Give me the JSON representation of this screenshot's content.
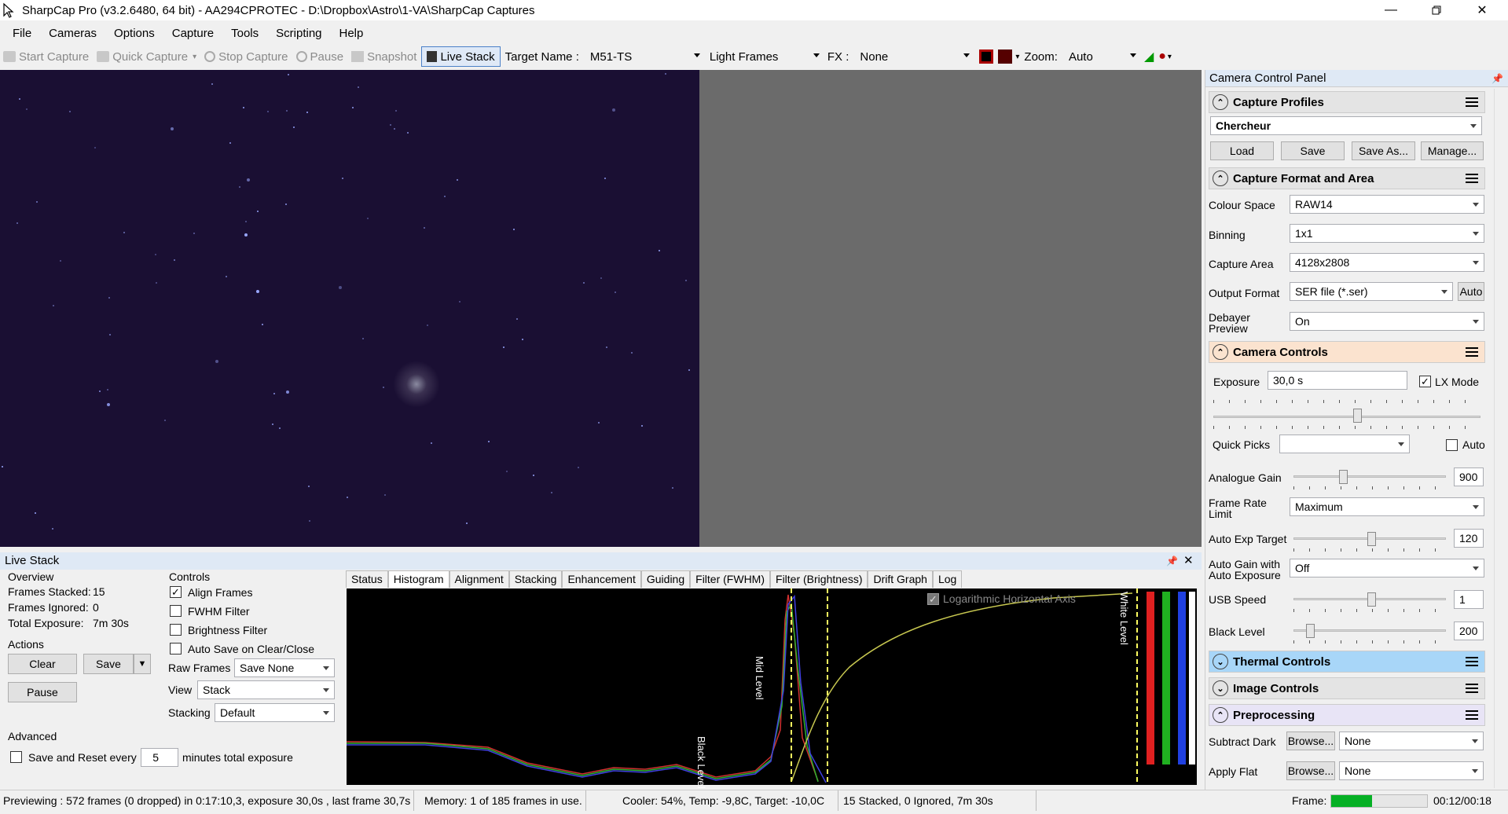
{
  "window": {
    "title": "SharpCap Pro (v3.2.6480, 64 bit) - AA294CPROTEC - D:\\Dropbox\\Astro\\1-VA\\SharpCap Captures"
  },
  "menu": [
    "File",
    "Cameras",
    "Options",
    "Capture",
    "Tools",
    "Scripting",
    "Help"
  ],
  "toolbar": {
    "start_capture": "Start Capture",
    "quick_capture": "Quick Capture",
    "stop_capture": "Stop Capture",
    "pause": "Pause",
    "snapshot": "Snapshot",
    "live_stack": "Live Stack",
    "target_label": "Target Name :",
    "target_value": "M51-TS",
    "frame_type": "Light Frames",
    "fx_label": "FX :",
    "fx_value": "None",
    "zoom_label": "Zoom:",
    "zoom_value": "Auto"
  },
  "ccp": {
    "title": "Camera Control Panel",
    "capture_profiles": {
      "title": "Capture Profiles",
      "profile": "Chercheur",
      "load": "Load",
      "save": "Save",
      "save_as": "Save As...",
      "manage": "Manage..."
    },
    "format_area": {
      "title": "Capture Format and Area",
      "colour_space_label": "Colour Space",
      "colour_space": "RAW14",
      "binning_label": "Binning",
      "binning": "1x1",
      "capture_area_label": "Capture Area",
      "capture_area": "4128x2808",
      "output_format_label": "Output Format",
      "output_format": "SER file (*.ser)",
      "auto": "Auto",
      "debayer_label1": "Debayer",
      "debayer_label2": "Preview",
      "debayer": "On"
    },
    "camera_controls": {
      "title": "Camera Controls",
      "exposure_label": "Exposure",
      "exposure": "30,0 s",
      "lx_mode": "LX Mode",
      "quick_picks_label": "Quick Picks",
      "auto": "Auto",
      "gain_label": "Analogue Gain",
      "gain": "900",
      "frame_rate_label1": "Frame Rate",
      "frame_rate_label2": "Limit",
      "frame_rate": "Maximum",
      "auto_exp_label": "Auto Exp Target",
      "auto_exp": "120",
      "auto_gain_label1": "Auto Gain with",
      "auto_gain_label2": "Auto Exposure",
      "auto_gain": "Off",
      "usb_label": "USB Speed",
      "usb": "1",
      "black_label": "Black Level",
      "black": "200"
    },
    "thermal": "Thermal Controls",
    "image_controls": "Image Controls",
    "preprocessing": {
      "title": "Preprocessing",
      "subtract_dark_label": "Subtract Dark",
      "browse": "Browse...",
      "dark": "None",
      "apply_flat_label": "Apply Flat",
      "flat": "None"
    }
  },
  "live_stack": {
    "title": "Live Stack",
    "overview": "Overview",
    "frames_stacked_label": "Frames Stacked:",
    "frames_stacked": "15",
    "frames_ignored_label": "Frames Ignored:",
    "frames_ignored": "0",
    "total_exposure_label": "Total Exposure:",
    "total_exposure": "7m 30s",
    "actions": "Actions",
    "clear": "Clear",
    "save": "Save",
    "pause": "Pause",
    "advanced": "Advanced",
    "save_reset": "Save and Reset every",
    "reset_minutes": "5",
    "minutes_text": "minutes total exposure",
    "controls": "Controls",
    "align_frames": "Align Frames",
    "fwhm_filter": "FWHM Filter",
    "brightness_filter": "Brightness Filter",
    "auto_save": "Auto Save on Clear/Close",
    "raw_frames_label": "Raw Frames",
    "raw_frames": "Save None",
    "view_label": "View",
    "view": "Stack",
    "stacking_label": "Stacking",
    "stacking": "Default",
    "tabs": [
      "Status",
      "Histogram",
      "Alignment",
      "Stacking",
      "Enhancement",
      "Guiding",
      "Filter (FWHM)",
      "Filter (Brightness)",
      "Drift Graph",
      "Log"
    ],
    "selected_tab": "Histogram",
    "hist": {
      "log_axis": "Logarithmic Horizontal Axis",
      "black_level": "Black Level",
      "mid_level": "Mid Level",
      "white_level": "White Level"
    }
  },
  "status": {
    "preview": "Previewing : 572 frames (0 dropped) in 0:17:10,3, exposure 30,0s , last frame 30,7s",
    "memory": "Memory: 1 of 185 frames in use.",
    "cooler": "Cooler: 54%, Temp: -9,8C, Target: -10,0C",
    "stacked": "15 Stacked, 0 Ignored, 7m 30s",
    "frame_label": "Frame:",
    "frame_progress": 0.43,
    "time": "00:12/00:18"
  }
}
